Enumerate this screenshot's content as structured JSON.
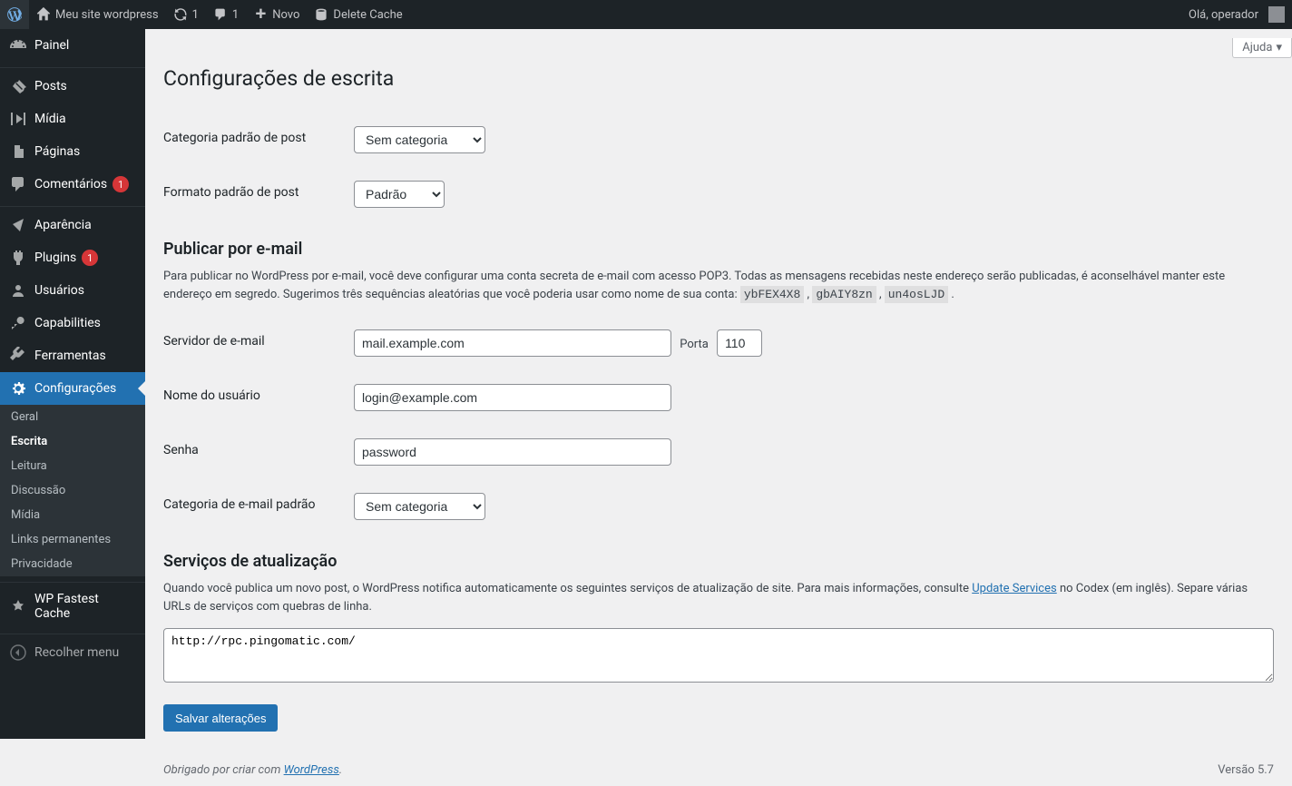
{
  "adminbar": {
    "site_name": "Meu site wordpress",
    "updates": "1",
    "comments": "1",
    "new_label": "Novo",
    "delete_cache": "Delete Cache",
    "greeting": "Olá, operador"
  },
  "sidebar": {
    "dashboard": "Painel",
    "posts": "Posts",
    "media": "Mídia",
    "pages": "Páginas",
    "comments": "Comentários",
    "comments_count": "1",
    "appearance": "Aparência",
    "plugins": "Plugins",
    "plugins_count": "1",
    "users": "Usuários",
    "capabilities": "Capabilities",
    "tools": "Ferramentas",
    "settings": "Configurações",
    "wp_fastest_cache": "WP Fastest Cache",
    "collapse": "Recolher menu",
    "submenu": {
      "general": "Geral",
      "writing": "Escrita",
      "reading": "Leitura",
      "discussion": "Discussão",
      "media": "Mídia",
      "permalinks": "Links permanentes",
      "privacy": "Privacidade"
    }
  },
  "help_label": "Ajuda",
  "page_title": "Configurações de escrita",
  "form": {
    "default_category_label": "Categoria padrão de post",
    "default_category_value": "Sem categoria",
    "default_format_label": "Formato padrão de post",
    "default_format_value": "Padrão",
    "email_section_title": "Publicar por e-mail",
    "email_section_desc_1": "Para publicar no WordPress por e-mail, você deve configurar uma conta secreta de e-mail com acesso POP3. Todas as mensagens recebidas neste endereço serão publicadas, é aconselhável manter este endereço em segredo. Sugerimos três sequências aleatórias que você poderia usar como nome de sua conta: ",
    "sugg1": "ybFEX4X8",
    "sugg2": "gbAIY8zn",
    "sugg3": "un4osLJD",
    "mail_server_label": "Servidor de e-mail",
    "mail_server_value": "mail.example.com",
    "port_label": "Porta",
    "port_value": "110",
    "login_label": "Nome do usuário",
    "login_value": "login@example.com",
    "password_label": "Senha",
    "password_value": "password",
    "mail_category_label": "Categoria de e-mail padrão",
    "mail_category_value": "Sem categoria",
    "update_section_title": "Serviços de atualização",
    "update_desc_1": "Quando você publica um novo post, o WordPress notifica automaticamente os seguintes serviços de atualização de site. Para mais informações, consulte ",
    "update_services_link": "Update Services",
    "update_desc_2": " no Codex (em inglês). Separe várias URLs de serviços com quebras de linha.",
    "ping_sites": "http://rpc.pingomatic.com/",
    "submit_label": "Salvar alterações"
  },
  "footer": {
    "thanks": "Obrigado por criar com ",
    "wp_link": "WordPress",
    "version": "Versão 5.7"
  }
}
